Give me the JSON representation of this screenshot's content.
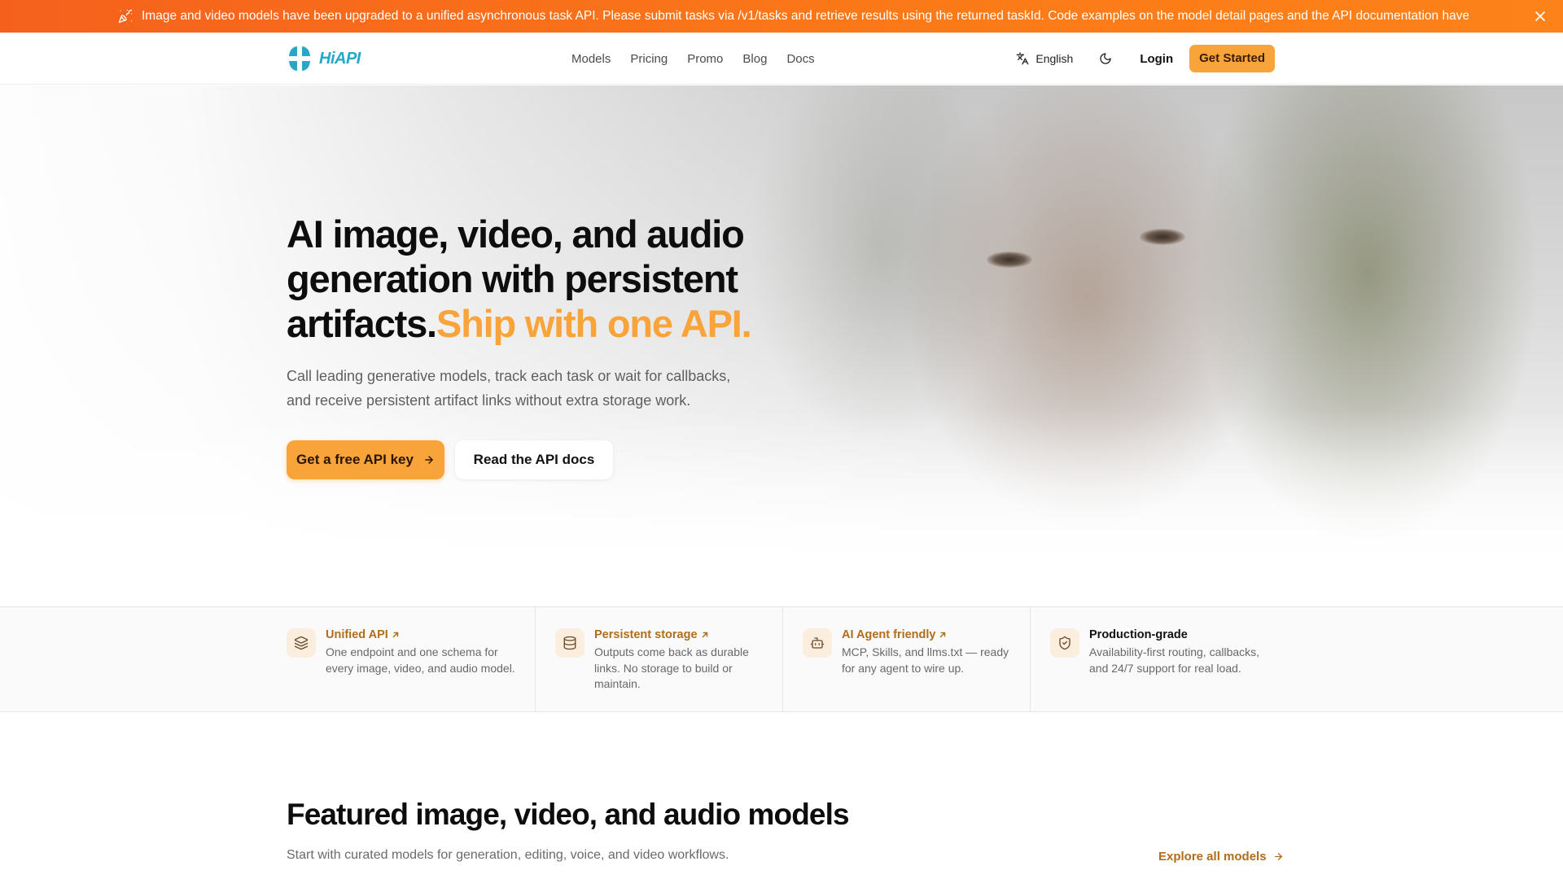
{
  "banner": {
    "text": "Image and video models have been upgraded to a unified asynchronous task API. Please submit tasks via /v1/tasks and retrieve results using the returned taskId. Code examples on the model detail pages and the API documentation have been ..."
  },
  "nav": {
    "brand": "HiAPI",
    "links": [
      "Models",
      "Pricing",
      "Promo",
      "Blog",
      "Docs"
    ],
    "language": "English",
    "login": "Login",
    "get_started": "Get Started"
  },
  "hero": {
    "title_main": "AI image, video, and audio generation with persistent artifacts.",
    "title_accent": "Ship with one API.",
    "subtitle": "Call leading generative models, track each task or wait for callbacks, and receive persistent artifact links without extra storage work.",
    "primary_cta": "Get a free API key",
    "secondary_cta": "Read the API docs"
  },
  "features": [
    {
      "title": "Unified API",
      "desc": "One endpoint and one schema for every image, video, and audio model.",
      "icon": "layers-icon"
    },
    {
      "title": "Persistent storage",
      "desc": "Outputs come back as durable links. No storage to build or maintain.",
      "icon": "database-icon"
    },
    {
      "title": "AI Agent friendly",
      "desc": "MCP, Skills, and llms.txt — ready for any agent to wire up.",
      "icon": "bot-icon"
    },
    {
      "title": "Production-grade",
      "desc": "Availability-first routing, callbacks, and 24/7 support for real load.",
      "icon": "shield-check-icon"
    }
  ],
  "featured": {
    "title": "Featured image, video, and audio models",
    "subtitle": "Start with curated models for generation, editing, voice, and video workflows.",
    "explore": "Explore all models"
  },
  "colors": {
    "banner": "#f5611d",
    "accent": "#f9a43a",
    "link_brown": "#b06d1a",
    "brand_teal": "#2aa6c9"
  }
}
